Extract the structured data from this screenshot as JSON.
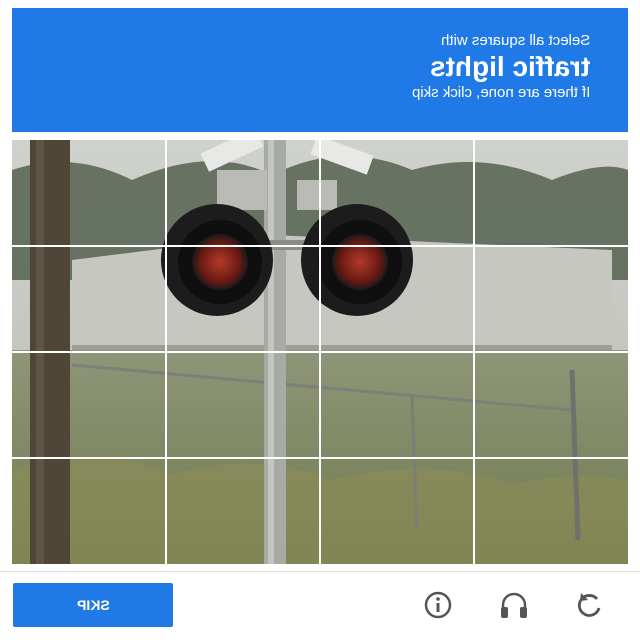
{
  "header": {
    "line1": "Select all squares with",
    "line2": "traffic lights",
    "line3": "If there are none, click skip"
  },
  "footer": {
    "skip_label": "SKIP"
  },
  "grid": {
    "rows": 4,
    "columns": 4
  },
  "colors": {
    "accent": "#1f7ae8",
    "icon": "#555555"
  },
  "icons": [
    "info-icon",
    "headphones-icon",
    "reload-icon"
  ]
}
